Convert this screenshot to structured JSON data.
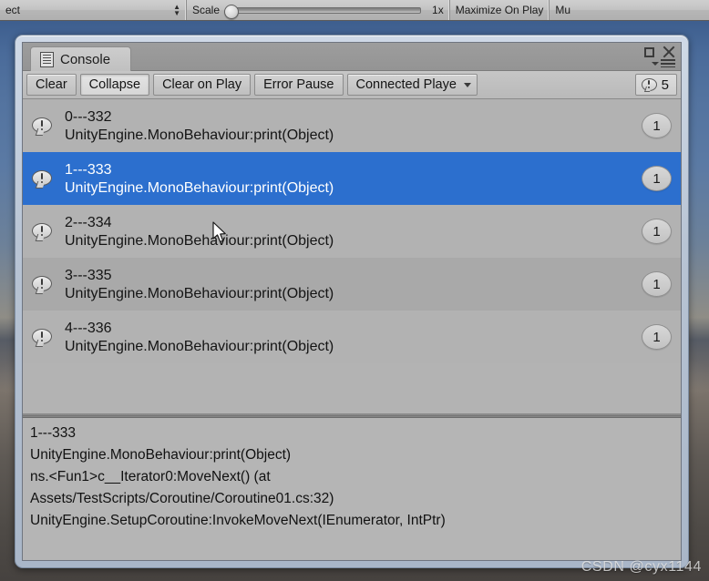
{
  "toolbar": {
    "aspect_value": "ect",
    "aspect_stepper_icon": "up-down-arrows-icon",
    "scale_label": "Scale",
    "scale_value": "1x",
    "maximize_on_play": "Maximize On Play",
    "mute_audio": "Mu"
  },
  "window": {
    "tab_label": "Console",
    "tab_icon": "console-document-icon",
    "maximize_icon": "maximize-icon",
    "close_icon": "close-icon",
    "menu_icon": "hamburger-menu-icon"
  },
  "console_toolbar": {
    "clear": "Clear",
    "collapse": "Collapse",
    "clear_on_play": "Clear on Play",
    "error_pause": "Error Pause",
    "connected_player": "Connected Playe",
    "connected_player_caret": "chevron-down-icon",
    "warning_icon": "log-warning-icon",
    "warning_count": "5"
  },
  "log_entries": [
    {
      "message": "0---332",
      "stack": "UnityEngine.MonoBehaviour:print(Object)",
      "count": "1",
      "icon": "log-warning-icon",
      "selected": false
    },
    {
      "message": "1---333",
      "stack": "UnityEngine.MonoBehaviour:print(Object)",
      "count": "1",
      "icon": "log-warning-icon",
      "selected": true
    },
    {
      "message": "2---334",
      "stack": "UnityEngine.MonoBehaviour:print(Object)",
      "count": "1",
      "icon": "log-warning-icon",
      "selected": false
    },
    {
      "message": "3---335",
      "stack": "UnityEngine.MonoBehaviour:print(Object)",
      "count": "1",
      "icon": "log-warning-icon",
      "selected": false
    },
    {
      "message": "4---336",
      "stack": "UnityEngine.MonoBehaviour:print(Object)",
      "count": "1",
      "icon": "log-warning-icon",
      "selected": false
    }
  ],
  "detail_pane": {
    "lines": [
      "1---333",
      "UnityEngine.MonoBehaviour:print(Object)",
      "ns.<Fun1>c__Iterator0:MoveNext() (at",
      "Assets/TestScripts/Coroutine/Coroutine01.cs:32)",
      "UnityEngine.SetupCoroutine:InvokeMoveNext(IEnumerator, IntPtr)"
    ]
  },
  "watermark": "CSDN @cyx1144",
  "colors": {
    "selection_blue": "#2c6fce",
    "panel_grey": "#b3b3b3",
    "window_frame": "#b8c4d4",
    "backdrop_blue": "#53739f"
  }
}
